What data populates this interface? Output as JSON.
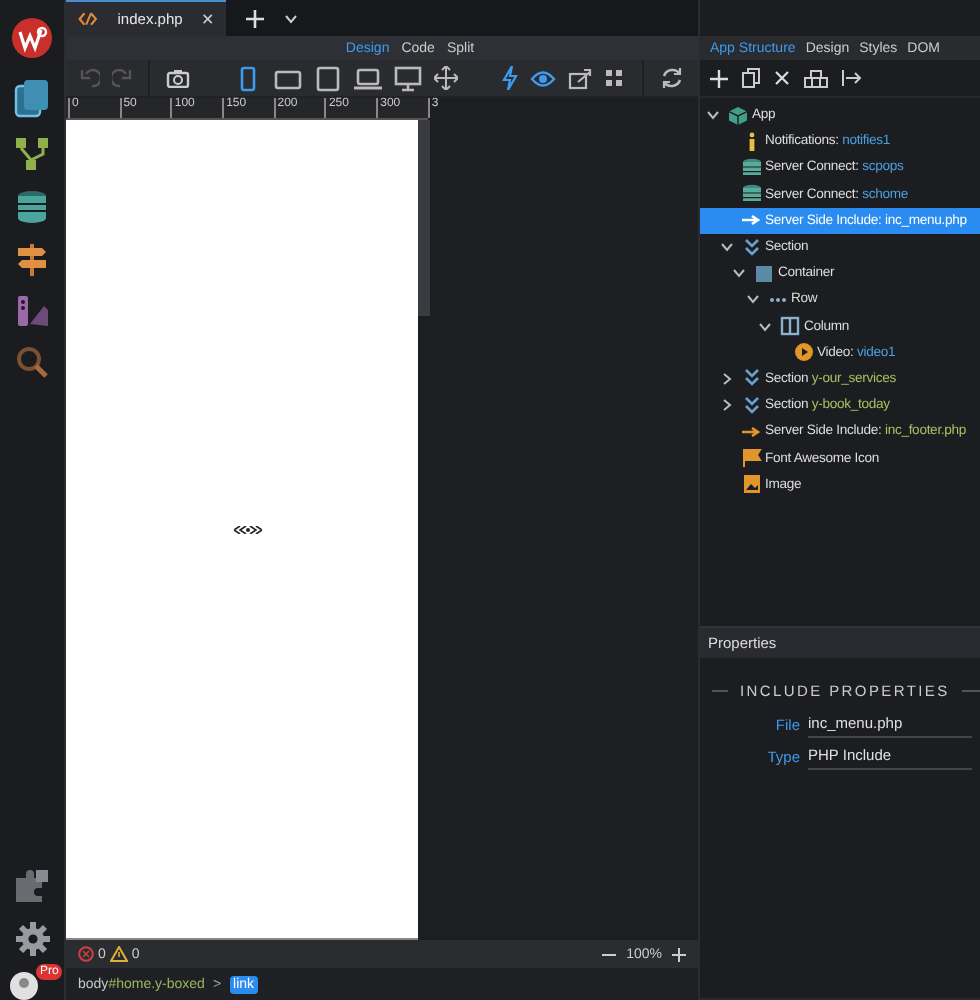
{
  "editor_tabs": [
    {
      "label": "index.php",
      "selected": true
    }
  ],
  "view_modes": [
    {
      "label": "Design",
      "selected": true
    },
    {
      "label": "Code",
      "selected": false
    },
    {
      "label": "Split",
      "selected": false
    }
  ],
  "devices": [
    {
      "kind": "phone",
      "selected": true
    },
    {
      "kind": "tablet-landscape",
      "selected": false
    },
    {
      "kind": "tablet",
      "selected": false
    },
    {
      "kind": "laptop",
      "selected": false
    },
    {
      "kind": "desktop",
      "selected": false
    }
  ],
  "ruler": {
    "ticks": [
      "0",
      "50",
      "100",
      "150",
      "200",
      "250",
      "300",
      "3"
    ]
  },
  "status_bar": {
    "errors": "0",
    "warnings": "0",
    "zoom": "100%"
  },
  "breadcrumb": [
    {
      "tag": "body",
      "selector": "#home.y-boxed",
      "separator": ">",
      "selected": false
    },
    {
      "tag": "link",
      "selected": true
    }
  ],
  "sidebar": {
    "badge": "Pro"
  },
  "panel_tabs": [
    {
      "label": "App Structure",
      "selected": true
    },
    {
      "label": "Design",
      "selected": false
    },
    {
      "label": "Styles",
      "selected": false
    },
    {
      "label": "DOM",
      "selected": false
    }
  ],
  "tree": [
    {
      "kind": "app",
      "label": "App",
      "expanded": true,
      "selected": false,
      "children": [
        {
          "kind": "notifications",
          "label": "Notifications:",
          "value": "notifies1",
          "selected": false
        },
        {
          "kind": "server-connect",
          "label": "Server Connect:",
          "value": "scpops",
          "selected": false
        },
        {
          "kind": "server-connect",
          "label": "Server Connect:",
          "value": "schome",
          "selected": false
        },
        {
          "kind": "server-include",
          "label": "Server Side Include:",
          "value": "inc_menu.php",
          "selected": true
        },
        {
          "kind": "section",
          "label": "Section",
          "expanded": true,
          "selected": false,
          "children": [
            {
              "kind": "container",
              "label": "Container",
              "expanded": true,
              "selected": false,
              "children": [
                {
                  "kind": "row",
                  "label": "Row",
                  "expanded": true,
                  "selected": false,
                  "children": [
                    {
                      "kind": "column",
                      "label": "Column",
                      "expanded": true,
                      "selected": false,
                      "children": [
                        {
                          "kind": "video",
                          "label": "Video:",
                          "value": "video1",
                          "selected": false
                        }
                      ]
                    }
                  ]
                }
              ]
            }
          ]
        },
        {
          "kind": "section",
          "label": "Section",
          "value": "y-our_services",
          "expanded": false,
          "selected": false
        },
        {
          "kind": "section",
          "label": "Section",
          "value": "y-book_today",
          "expanded": false,
          "selected": false
        },
        {
          "kind": "server-include",
          "label": "Server Side Include:",
          "value": "inc_footer.php",
          "selected": false
        },
        {
          "kind": "font-awesome",
          "label": "Font Awesome Icon",
          "selected": false
        },
        {
          "kind": "image",
          "label": "Image",
          "selected": false
        }
      ]
    }
  ],
  "properties": {
    "title": "Properties",
    "section": "INCLUDE PROPERTIES",
    "fields": [
      {
        "label": "File",
        "value": "inc_menu.php"
      },
      {
        "label": "Type",
        "value": "PHP Include"
      }
    ]
  }
}
